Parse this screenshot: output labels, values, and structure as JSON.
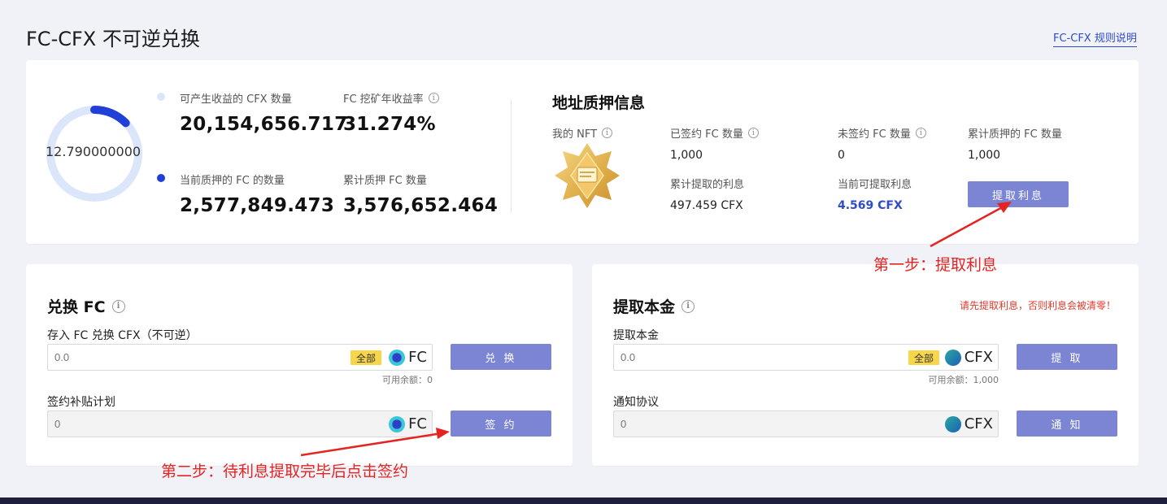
{
  "header": {
    "title": "FC-CFX 不可逆兑换",
    "rules_link": "FC-CFX 规则说明"
  },
  "stats": {
    "ring_value": "12.790000000",
    "ring_progress": 0.127,
    "cfx_earning_label": "可产生收益的 CFX 数量",
    "cfx_earning_value": "20,154,656.717",
    "apy_label": "FC 挖矿年收益率",
    "apy_value": "31.274%",
    "current_fc_label": "当前质押的 FC 的数量",
    "current_fc_value": "2,577,849.473",
    "total_fc_label": "累计质押 FC 数量",
    "total_fc_value": "3,576,652.464"
  },
  "pledge": {
    "title": "地址质押信息",
    "nft_label": "我的 NFT",
    "signed_label": "已签约 FC 数量",
    "signed_value": "1,000",
    "unsigned_label": "未签约 FC 数量",
    "unsigned_value": "0",
    "cumulative_label": "累计质押的 FC 数量",
    "cumulative_value": "1,000",
    "withdrawn_interest_label": "累计提取的利息",
    "withdrawn_interest_value": "497.459 CFX",
    "available_interest_label": "当前可提取利息",
    "available_interest_value": "4.569 CFX",
    "withdraw_interest_button": "提取利息"
  },
  "exchange": {
    "title": "兑换 FC",
    "deposit_label": "存入 FC 兑换 CFX（不可逆）",
    "deposit_placeholder": "0.0",
    "all_tag": "全部",
    "token": "FC",
    "exchange_button": "兑 换",
    "balance": "可用余额：0",
    "sign_label": "签约补贴计划",
    "sign_placeholder": "0",
    "sign_button": "签 约"
  },
  "withdraw": {
    "title": "提取本金",
    "warning": "请先提取利息，否则利息会被清零！",
    "principal_label": "提取本金",
    "principal_placeholder": "0.0",
    "all_tag": "全部",
    "token": "CFX",
    "withdraw_button": "提 取",
    "balance": "可用余额：1,000",
    "notify_label": "通知协议",
    "notify_placeholder": "0",
    "notify_button": "通 知"
  },
  "annotations": {
    "step1": "第一步：提取利息",
    "step2": "第二步：待利息提取完毕后点击签约"
  },
  "colors": {
    "accent": "#2f4bc7",
    "button": "#7b85d4",
    "ring_track": "#dce6fb",
    "ring_fill": "#1f3fd6",
    "tag": "#f7d64b",
    "annotation": "#e32421",
    "warning": "#e23a2e"
  }
}
